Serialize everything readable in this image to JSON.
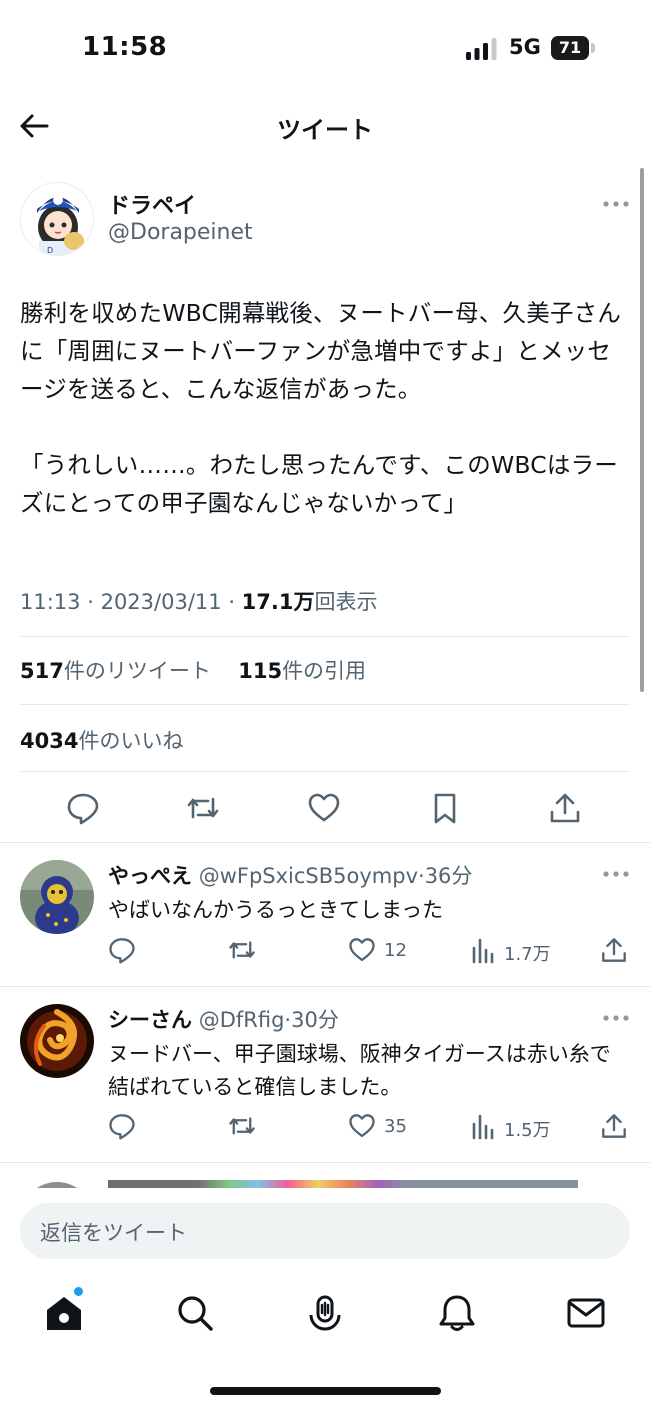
{
  "status_bar": {
    "time": "11:58",
    "network": "5G",
    "battery": "71"
  },
  "header": {
    "title": "ツイート"
  },
  "tweet": {
    "author_name": "ドラペイ",
    "author_handle": "@Dorapeinet",
    "text": "勝利を収めたWBC開幕戦後、ヌートバー母、久美子さんに「周囲にヌートバーファンが急増中ですよ」とメッセージを送ると、こんな返信があった。\n\n「うれしい……。わたし思ったんです、このWBCはラーズにとっての甲子園なんじゃないかって」",
    "time": "11:13",
    "date": "2023/03/11",
    "views_value": "17.1万",
    "views_label": "回表示",
    "retweets_value": "517",
    "retweets_label": "件のリツイート",
    "quotes_value": "115",
    "quotes_label": "件の引用",
    "likes_value": "4034",
    "likes_label": "件のいいね"
  },
  "replies": [
    {
      "name": "やっぺえ",
      "handle": "@wFpSxicSB5oympv",
      "time": "36分",
      "text": "やばいなんかうるっときてしまった",
      "likes": "12",
      "views": "1.7万"
    },
    {
      "name": "シーさん",
      "handle": "@DfRfig",
      "time": "30分",
      "text": "ヌードバー、甲子園球場、阪神タイガースは赤い糸で結ばれていると確信しました。",
      "likes": "35",
      "views": "1.5万"
    }
  ],
  "compose": {
    "placeholder": "返信をツイート"
  },
  "colors": {
    "accent": "#1d9bf0",
    "text": "#0f1419",
    "muted": "#536471",
    "divider": "#e6e9ec"
  },
  "icons": [
    "back-arrow-icon",
    "more-icon",
    "reply-icon",
    "retweet-icon",
    "like-icon",
    "bookmark-icon",
    "share-icon",
    "views-icon",
    "home-icon",
    "search-icon",
    "spaces-icon",
    "notifications-icon",
    "messages-icon"
  ]
}
